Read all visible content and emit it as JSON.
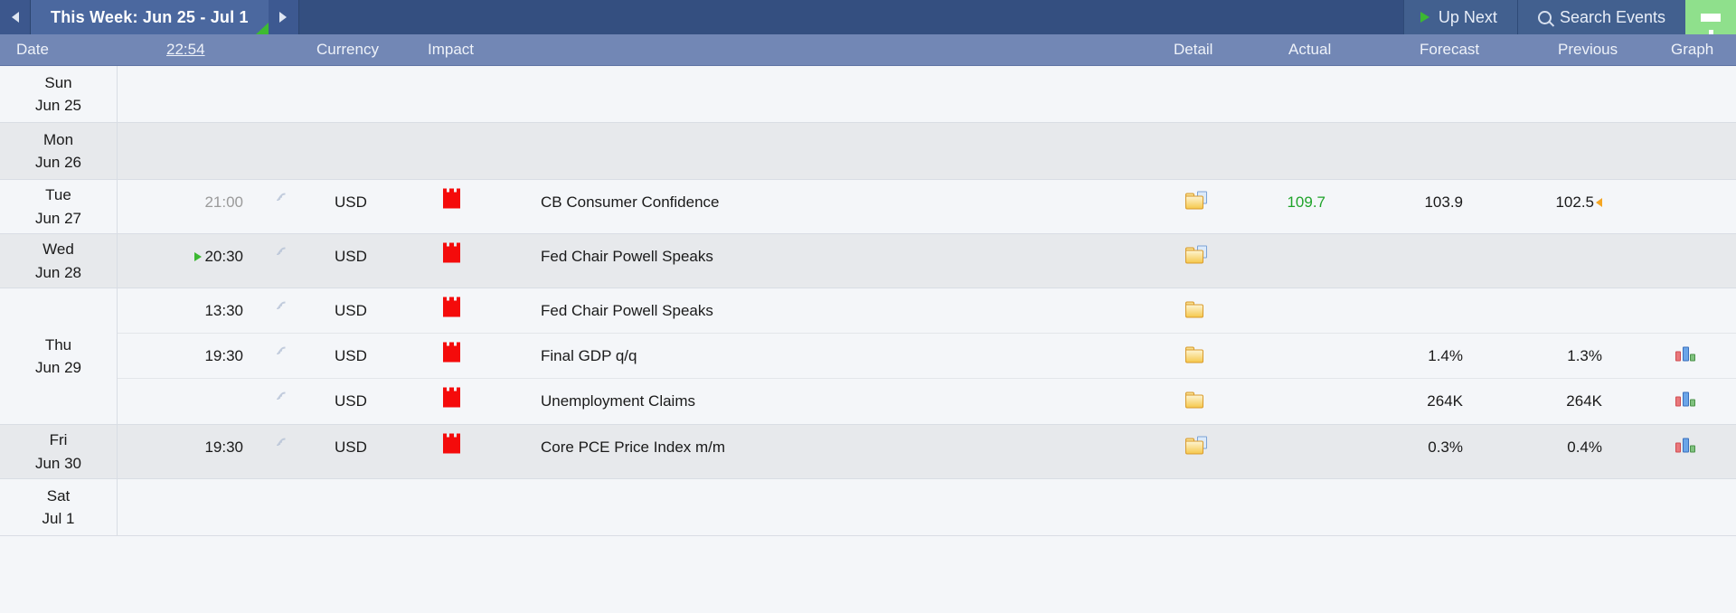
{
  "topbar": {
    "prev_icon": "triangle-left-icon",
    "next_icon": "triangle-right-icon",
    "week_label": "This Week: Jun 25 - Jul 1",
    "up_next_label": "Up Next",
    "up_next_icon": "play-icon",
    "search_label": "Search Events",
    "search_icon": "search-icon",
    "filter_icon": "funnel-icon",
    "accent_green": "#8fe08c",
    "bar_blue": "#344f80",
    "tab_blue": "#4b689f"
  },
  "columns": {
    "date": "Date",
    "time": "22:54",
    "currency": "Currency",
    "impact": "Impact",
    "detail": "Detail",
    "actual": "Actual",
    "forecast": "Forecast",
    "previous": "Previous",
    "graph": "Graph"
  },
  "days": [
    {
      "weekday": "Sun",
      "daydate": "Jun 25",
      "shade": "light",
      "events": []
    },
    {
      "weekday": "Mon",
      "daydate": "Jun 26",
      "shade": "dark",
      "events": []
    },
    {
      "weekday": "Tue",
      "daydate": "Jun 27",
      "shade": "light",
      "events": [
        {
          "time": "21:00",
          "time_style": "grey",
          "time_marker": false,
          "sound_icon": "sound-icon",
          "currency": "USD",
          "impact_icon": "high-impact-flag-icon",
          "title": "CB Consumer Confidence",
          "detail_icon": "folder-document-icon",
          "actual": "109.7",
          "actual_color": "green",
          "forecast": "103.9",
          "previous": "102.5",
          "previous_revised": true,
          "graph_icon": null
        }
      ]
    },
    {
      "weekday": "Wed",
      "daydate": "Jun 28",
      "shade": "dark",
      "events": [
        {
          "time": "20:30",
          "time_style": "normal",
          "time_marker": true,
          "sound_icon": "sound-icon",
          "currency": "USD",
          "impact_icon": "high-impact-flag-icon",
          "title": "Fed Chair Powell Speaks",
          "detail_icon": "folder-document-icon",
          "actual": "",
          "actual_color": "normal",
          "forecast": "",
          "previous": "",
          "previous_revised": false,
          "graph_icon": null
        }
      ]
    },
    {
      "weekday": "Thu",
      "daydate": "Jun 29",
      "shade": "light",
      "events": [
        {
          "time": "13:30",
          "time_style": "normal",
          "time_marker": false,
          "sound_icon": "sound-icon",
          "currency": "USD",
          "impact_icon": "high-impact-flag-icon",
          "title": "Fed Chair Powell Speaks",
          "detail_icon": "folder-icon",
          "actual": "",
          "actual_color": "normal",
          "forecast": "",
          "previous": "",
          "previous_revised": false,
          "graph_icon": null
        },
        {
          "time": "19:30",
          "time_style": "normal",
          "time_marker": false,
          "sound_icon": "sound-icon",
          "currency": "USD",
          "impact_icon": "high-impact-flag-icon",
          "title": "Final GDP q/q",
          "detail_icon": "folder-icon",
          "actual": "",
          "actual_color": "normal",
          "forecast": "1.4%",
          "previous": "1.3%",
          "previous_revised": false,
          "graph_icon": "bar-chart-icon"
        },
        {
          "time": "",
          "time_style": "normal",
          "time_marker": false,
          "sound_icon": "sound-icon",
          "currency": "USD",
          "impact_icon": "high-impact-flag-icon",
          "title": "Unemployment Claims",
          "detail_icon": "folder-icon",
          "actual": "",
          "actual_color": "normal",
          "forecast": "264K",
          "previous": "264K",
          "previous_revised": false,
          "graph_icon": "bar-chart-icon"
        }
      ]
    },
    {
      "weekday": "Fri",
      "daydate": "Jun 30",
      "shade": "dark",
      "events": [
        {
          "time": "19:30",
          "time_style": "normal",
          "time_marker": false,
          "sound_icon": "sound-icon",
          "currency": "USD",
          "impact_icon": "high-impact-flag-icon",
          "title": "Core PCE Price Index m/m",
          "detail_icon": "folder-document-icon",
          "actual": "",
          "actual_color": "normal",
          "forecast": "0.3%",
          "previous": "0.4%",
          "previous_revised": false,
          "graph_icon": "bar-chart-icon"
        }
      ]
    },
    {
      "weekday": "Sat",
      "daydate": "Jul 1",
      "shade": "light",
      "events": []
    }
  ]
}
